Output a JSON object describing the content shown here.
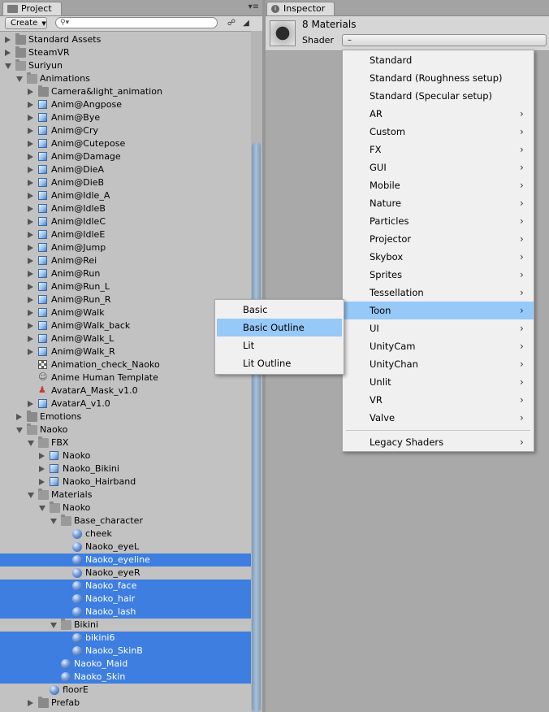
{
  "project": {
    "tab_label": "Project",
    "create_label": "Create",
    "search_placeholder": "",
    "tree": [
      {
        "label": "Standard Assets",
        "level": 0,
        "arrow": "collapsed",
        "icon": "folder"
      },
      {
        "label": "SteamVR",
        "level": 0,
        "arrow": "collapsed",
        "icon": "folder"
      },
      {
        "label": "Suriyun",
        "level": 0,
        "arrow": "expanded",
        "icon": "folder-open"
      },
      {
        "label": "Animations",
        "level": 1,
        "arrow": "expanded",
        "icon": "folder-open"
      },
      {
        "label": "Camera&light_animation",
        "level": 2,
        "arrow": "collapsed",
        "icon": "folder"
      },
      {
        "label": "Anim@Angpose",
        "level": 2,
        "arrow": "collapsed",
        "icon": "cube"
      },
      {
        "label": "Anim@Bye",
        "level": 2,
        "arrow": "collapsed",
        "icon": "cube"
      },
      {
        "label": "Anim@Cry",
        "level": 2,
        "arrow": "collapsed",
        "icon": "cube"
      },
      {
        "label": "Anim@Cutepose",
        "level": 2,
        "arrow": "collapsed",
        "icon": "cube"
      },
      {
        "label": "Anim@Damage",
        "level": 2,
        "arrow": "collapsed",
        "icon": "cube"
      },
      {
        "label": "Anim@DieA",
        "level": 2,
        "arrow": "collapsed",
        "icon": "cube"
      },
      {
        "label": "Anim@DieB",
        "level": 2,
        "arrow": "collapsed",
        "icon": "cube"
      },
      {
        "label": "Anim@Idle_A",
        "level": 2,
        "arrow": "collapsed",
        "icon": "cube"
      },
      {
        "label": "Anim@IdleB",
        "level": 2,
        "arrow": "collapsed",
        "icon": "cube"
      },
      {
        "label": "Anim@IdleC",
        "level": 2,
        "arrow": "collapsed",
        "icon": "cube"
      },
      {
        "label": "Anim@IdleE",
        "level": 2,
        "arrow": "collapsed",
        "icon": "cube"
      },
      {
        "label": "Anim@Jump",
        "level": 2,
        "arrow": "collapsed",
        "icon": "cube"
      },
      {
        "label": "Anim@Rei",
        "level": 2,
        "arrow": "collapsed",
        "icon": "cube"
      },
      {
        "label": "Anim@Run",
        "level": 2,
        "arrow": "collapsed",
        "icon": "cube"
      },
      {
        "label": "Anim@Run_L",
        "level": 2,
        "arrow": "collapsed",
        "icon": "cube"
      },
      {
        "label": "Anim@Run_R",
        "level": 2,
        "arrow": "collapsed",
        "icon": "cube"
      },
      {
        "label": "Anim@Walk",
        "level": 2,
        "arrow": "collapsed",
        "icon": "cube"
      },
      {
        "label": "Anim@Walk_back",
        "level": 2,
        "arrow": "collapsed",
        "icon": "cube"
      },
      {
        "label": "Anim@Walk_L",
        "level": 2,
        "arrow": "collapsed",
        "icon": "cube"
      },
      {
        "label": "Anim@Walk_R",
        "level": 2,
        "arrow": "collapsed",
        "icon": "cube"
      },
      {
        "label": "Animation_check_Naoko",
        "level": 2,
        "arrow": "none",
        "icon": "animator"
      },
      {
        "label": "Anime Human Template",
        "level": 2,
        "arrow": "none",
        "icon": "humanoid"
      },
      {
        "label": "AvatarA_Mask_v1.0",
        "level": 2,
        "arrow": "none",
        "icon": "mask"
      },
      {
        "label": "AvatarA_v1.0",
        "level": 2,
        "arrow": "collapsed",
        "icon": "cube"
      },
      {
        "label": "Emotions",
        "level": 1,
        "arrow": "collapsed",
        "icon": "folder"
      },
      {
        "label": "Naoko",
        "level": 1,
        "arrow": "expanded",
        "icon": "folder-open"
      },
      {
        "label": "FBX",
        "level": 2,
        "arrow": "expanded",
        "icon": "folder-open"
      },
      {
        "label": "Naoko",
        "level": 3,
        "arrow": "collapsed",
        "icon": "cube"
      },
      {
        "label": "Naoko_Bikini",
        "level": 3,
        "arrow": "collapsed",
        "icon": "cube"
      },
      {
        "label": "Naoko_Hairband",
        "level": 3,
        "arrow": "collapsed",
        "icon": "cube"
      },
      {
        "label": "Materials",
        "level": 2,
        "arrow": "expanded",
        "icon": "folder-open"
      },
      {
        "label": "Naoko",
        "level": 3,
        "arrow": "expanded",
        "icon": "folder-open"
      },
      {
        "label": "Base_character",
        "level": 4,
        "arrow": "expanded",
        "icon": "folder-open"
      },
      {
        "label": "cheek",
        "level": 5,
        "arrow": "none",
        "icon": "sphere"
      },
      {
        "label": "Naoko_eyeL",
        "level": 5,
        "arrow": "none",
        "icon": "sphere"
      },
      {
        "label": "Naoko_eyeline",
        "level": 5,
        "arrow": "none",
        "icon": "sphere",
        "selected": true
      },
      {
        "label": "Naoko_eyeR",
        "level": 5,
        "arrow": "none",
        "icon": "sphere"
      },
      {
        "label": "Naoko_face",
        "level": 5,
        "arrow": "none",
        "icon": "sphere",
        "selected": true
      },
      {
        "label": "Naoko_hair",
        "level": 5,
        "arrow": "none",
        "icon": "sphere",
        "selected": true
      },
      {
        "label": "Naoko_lash",
        "level": 5,
        "arrow": "none",
        "icon": "sphere",
        "selected": true
      },
      {
        "label": "Bikini",
        "level": 4,
        "arrow": "expanded",
        "icon": "folder-open"
      },
      {
        "label": "bikini6",
        "level": 5,
        "arrow": "none",
        "icon": "sphere",
        "selected": true
      },
      {
        "label": "Naoko_SkinB",
        "level": 5,
        "arrow": "none",
        "icon": "sphere",
        "selected": true
      },
      {
        "label": "Naoko_Maid",
        "level": 4,
        "arrow": "none",
        "icon": "sphere",
        "selected": true
      },
      {
        "label": "Naoko_Skin",
        "level": 4,
        "arrow": "none",
        "icon": "sphere",
        "selected": true
      },
      {
        "label": "floorE",
        "level": 3,
        "arrow": "none",
        "icon": "sphere"
      },
      {
        "label": "Prefab",
        "level": 2,
        "arrow": "collapsed",
        "icon": "folder"
      }
    ]
  },
  "inspector": {
    "tab_label": "Inspector",
    "title": "8 Materials",
    "shader_label": "Shader",
    "shader_value": "–"
  },
  "shader_menu": {
    "items": [
      {
        "label": "Standard",
        "submenu": false
      },
      {
        "label": "Standard (Roughness setup)",
        "submenu": false
      },
      {
        "label": "Standard (Specular setup)",
        "submenu": false
      },
      {
        "label": "AR",
        "submenu": true
      },
      {
        "label": "Custom",
        "submenu": true
      },
      {
        "label": "FX",
        "submenu": true
      },
      {
        "label": "GUI",
        "submenu": true
      },
      {
        "label": "Mobile",
        "submenu": true
      },
      {
        "label": "Nature",
        "submenu": true
      },
      {
        "label": "Particles",
        "submenu": true
      },
      {
        "label": "Projector",
        "submenu": true
      },
      {
        "label": "Skybox",
        "submenu": true
      },
      {
        "label": "Sprites",
        "submenu": true
      },
      {
        "label": "Tessellation",
        "submenu": true
      },
      {
        "label": "Toon",
        "submenu": true,
        "highlighted": true
      },
      {
        "label": "UI",
        "submenu": true
      },
      {
        "label": "UnityCam",
        "submenu": true
      },
      {
        "label": "UnityChan",
        "submenu": true
      },
      {
        "label": "Unlit",
        "submenu": true
      },
      {
        "label": "VR",
        "submenu": true
      },
      {
        "label": "Valve",
        "submenu": true
      }
    ],
    "footer_item": {
      "label": "Legacy Shaders",
      "submenu": true
    }
  },
  "toon_submenu": {
    "items": [
      {
        "label": "Basic"
      },
      {
        "label": "Basic Outline",
        "highlighted": true
      },
      {
        "label": "Lit"
      },
      {
        "label": "Lit Outline"
      }
    ]
  },
  "colors": {
    "selection": "#3d7ee0",
    "menu_highlight": "#96c8f8",
    "panel_bg": "#c2c2c2",
    "inspector_bg": "#a9a9a9"
  }
}
